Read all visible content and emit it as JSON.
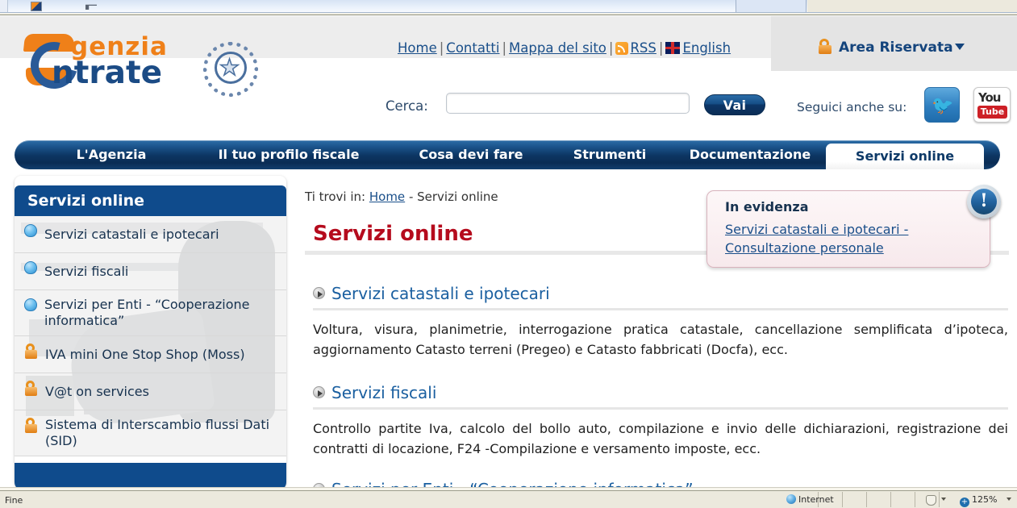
{
  "browser": {
    "status_text": "Fine",
    "zone_label": "Internet",
    "zoom_label": "125%"
  },
  "header": {
    "logo": {
      "line1": "genzia",
      "line2": "ntrate",
      "emblem_name": "italian-republic-emblem"
    },
    "top_links": [
      {
        "label": "Home",
        "icon": null
      },
      {
        "label": "Contatti",
        "icon": null
      },
      {
        "label": "Mappa del sito",
        "icon": null
      },
      {
        "label": "RSS",
        "icon": "rss-icon"
      },
      {
        "label": "English",
        "icon": "uk-flag-icon"
      }
    ],
    "separator": "|",
    "area_riservata": {
      "label": "Area Riservata",
      "icon": "lock-icon",
      "caret": "chevron-down-icon"
    },
    "search": {
      "label": "Cerca:",
      "value": "",
      "placeholder": "",
      "button_label": "Vai"
    },
    "social": {
      "label": "Seguici anche su:",
      "items": [
        {
          "name": "twitter-icon",
          "glyph": "\u0000"
        },
        {
          "name": "youtube-icon",
          "you": "You",
          "tube": "Tube"
        }
      ]
    }
  },
  "nav": {
    "items": [
      {
        "label": "L'Agenzia",
        "active": false
      },
      {
        "label": "Il tuo profilo fiscale",
        "active": false
      },
      {
        "label": "Cosa devi fare",
        "active": false
      },
      {
        "label": "Strumenti",
        "active": false
      },
      {
        "label": "Documentazione",
        "active": false
      },
      {
        "label": "Servizi online",
        "active": true
      }
    ]
  },
  "sidebar": {
    "title": "Servizi online",
    "items": [
      {
        "label": "Servizi catastali e ipotecari",
        "icon": "globe-icon"
      },
      {
        "label": "Servizi fiscali",
        "icon": "globe-icon"
      },
      {
        "label": "Servizi per Enti - “Cooperazione informatica”",
        "icon": "globe-icon"
      },
      {
        "label": "IVA mini One Stop Shop (Moss)",
        "icon": "lock-icon"
      },
      {
        "label": "V@t on services",
        "icon": "lock-icon"
      },
      {
        "label": "Sistema di Interscambio flussi Dati (SID)",
        "icon": "lock-icon"
      }
    ]
  },
  "content": {
    "breadcrumb": {
      "prefix": "Ti trovi in:",
      "home": "Home",
      "separator": "-",
      "current": "Servizi online"
    },
    "page_title": "Servizi online",
    "evidenza": {
      "title": "In evidenza",
      "link": "Servizi catastali e ipotecari - Consultazione personale",
      "badge_glyph": "!"
    },
    "sections": [
      {
        "heading": "Servizi catastali e ipotecari",
        "body": "Voltura, visura, planimetrie, interrogazione pratica catastale, cancellazione semplificata d’ipoteca, aggiornamento Catasto terreni (Pregeo) e Catasto fabbricati (Docfa), ecc."
      },
      {
        "heading": "Servizi fiscali",
        "body": "Controllo partite Iva, calcolo del bollo auto, compilazione e invio delle dichiarazioni, registrazione dei contratti di locazione, F24 -Compilazione e versamento imposte, ecc."
      },
      {
        "heading": "Servizi per Enti - “Cooperazione informatica”",
        "body": ""
      }
    ]
  },
  "colors": {
    "brand_orange": "#ef8019",
    "brand_blue": "#1b4b85",
    "nav_blue": "#0d3663",
    "title_red": "#b50b1d",
    "link_blue": "#1a4f8a",
    "sidebar_header": "#0f4b8c"
  }
}
